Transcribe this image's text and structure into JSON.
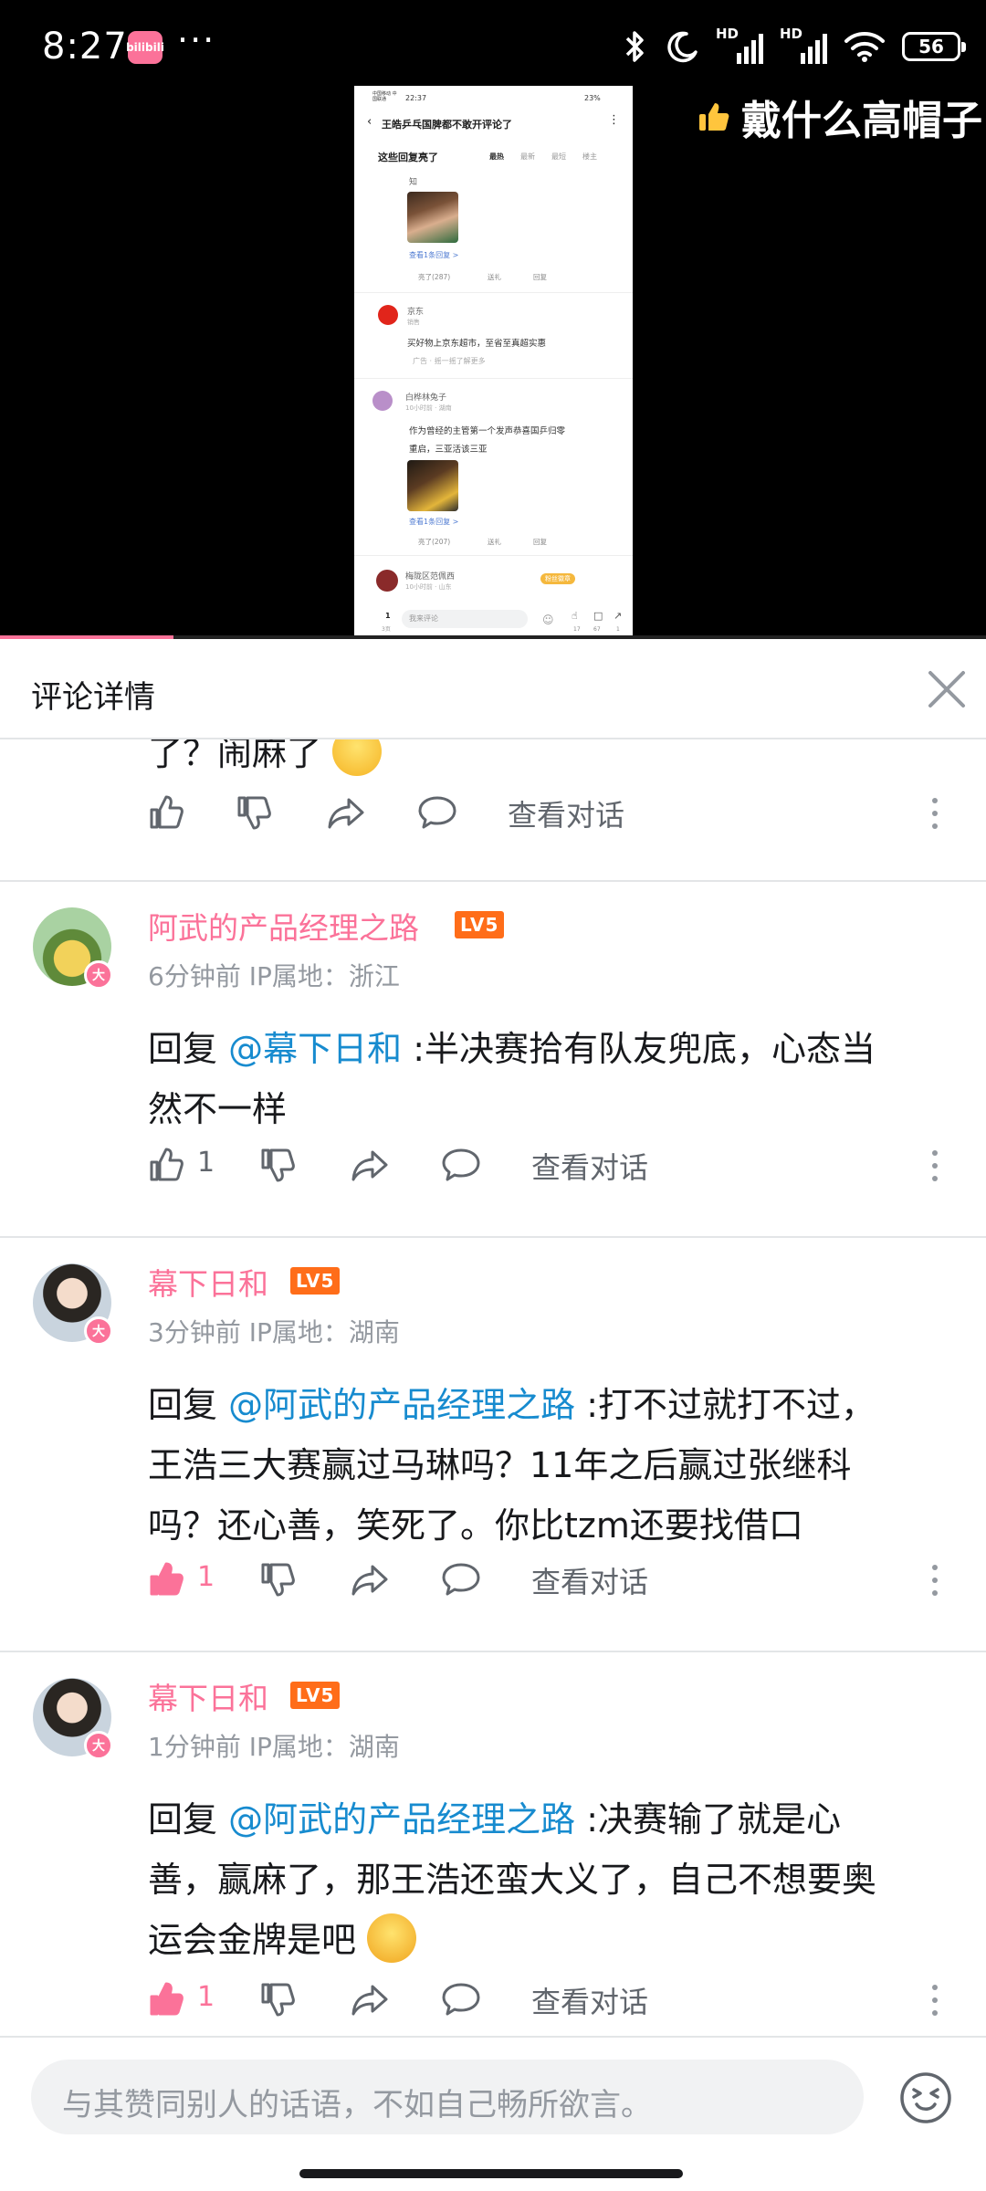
{
  "status_bar": {
    "time": "8:27",
    "app_icon_text": "bilibili",
    "more": "···",
    "signal_1": "HD",
    "signal_2": "HD",
    "battery": "56"
  },
  "danmaku": {
    "text": "戴什么高帽子"
  },
  "video_frame": {
    "status_left": "中国移动 中国联通",
    "status_time": "22:37",
    "status_battery": "23%",
    "title": "王皓乒乓国脾都不敢开评论了",
    "section_title": "这些回复亮了",
    "tabs": [
      "最热",
      "最新",
      "最短",
      "楼主"
    ],
    "c1_name": "知",
    "c1_link": "查看1条回复 >",
    "c1_like": "亮了(287)",
    "c1_gift": "送礼",
    "c1_reply": "回复",
    "ad_name": "京东",
    "ad_sub": "销售",
    "ad_text": "买好物上京东超市，至省至真超实惠",
    "ad_tag": "广告 · 摇一摇了解更多",
    "c2_name": "白桦林兔子",
    "c2_meta": "10小时前 · 湖南",
    "c2_text_1": "作为曾经的主管第一个发声恭喜国乒归零",
    "c2_text_2": "重启，三亚活该三亚",
    "c2_link": "查看1条回复 >",
    "c2_like": "亮了(207)",
    "c2_gift": "送礼",
    "c2_reply": "回复",
    "c3_name": "梅陇区范佩西",
    "c3_meta": "10小时前 · 山东",
    "c3_badge": "粉丝徽章",
    "page_num": "1",
    "page_total": "3页",
    "input_placeholder": "我来评论",
    "count_likes": "17",
    "count_comments": "67",
    "count_shares": "1"
  },
  "progress": {
    "fraction": 0.176
  },
  "panel": {
    "title": "评论详情"
  },
  "partial_comment": {
    "text": "了？闹麻了"
  },
  "labels": {
    "view_conversation": "查看对话",
    "reply_prefix": "回复 "
  },
  "comments": [
    {
      "username": "阿武的产品经理之路",
      "level": "LV5",
      "badge": "大",
      "meta": "6分钟前 IP属地：浙江",
      "mention": "@幕下日和",
      "text_1": " :半决赛拾有队友兜底，心态当",
      "text_2": "然不一样",
      "likes": "1",
      "liked": false
    },
    {
      "username": "幕下日和",
      "level": "LV5",
      "badge": "大",
      "meta": "3分钟前 IP属地：湖南",
      "mention": "@阿武的产品经理之路",
      "text_1": " :打不过就打不过，",
      "text_2": "王浩三大赛赢过马琳吗？11年之后赢过张继科",
      "text_3": "吗？还心善，笑死了。你比tzm还要找借口",
      "likes": "1",
      "liked": true
    },
    {
      "username": "幕下日和",
      "level": "LV5",
      "badge": "大",
      "meta": "1分钟前 IP属地：湖南",
      "mention": "@阿武的产品经理之路",
      "text_1": " :决赛输了就是心",
      "text_2": "善，赢麻了，那王浩还蛮大义了，自己不想要奥",
      "text_3": "运会金牌是吧",
      "likes": "1",
      "liked": true
    }
  ],
  "input": {
    "placeholder": "与其赞同别人的话语，不如自己畅所欲言。"
  },
  "colors": {
    "accent": "#fb7299",
    "mention": "#178bcf",
    "level": "#ff6d19"
  }
}
